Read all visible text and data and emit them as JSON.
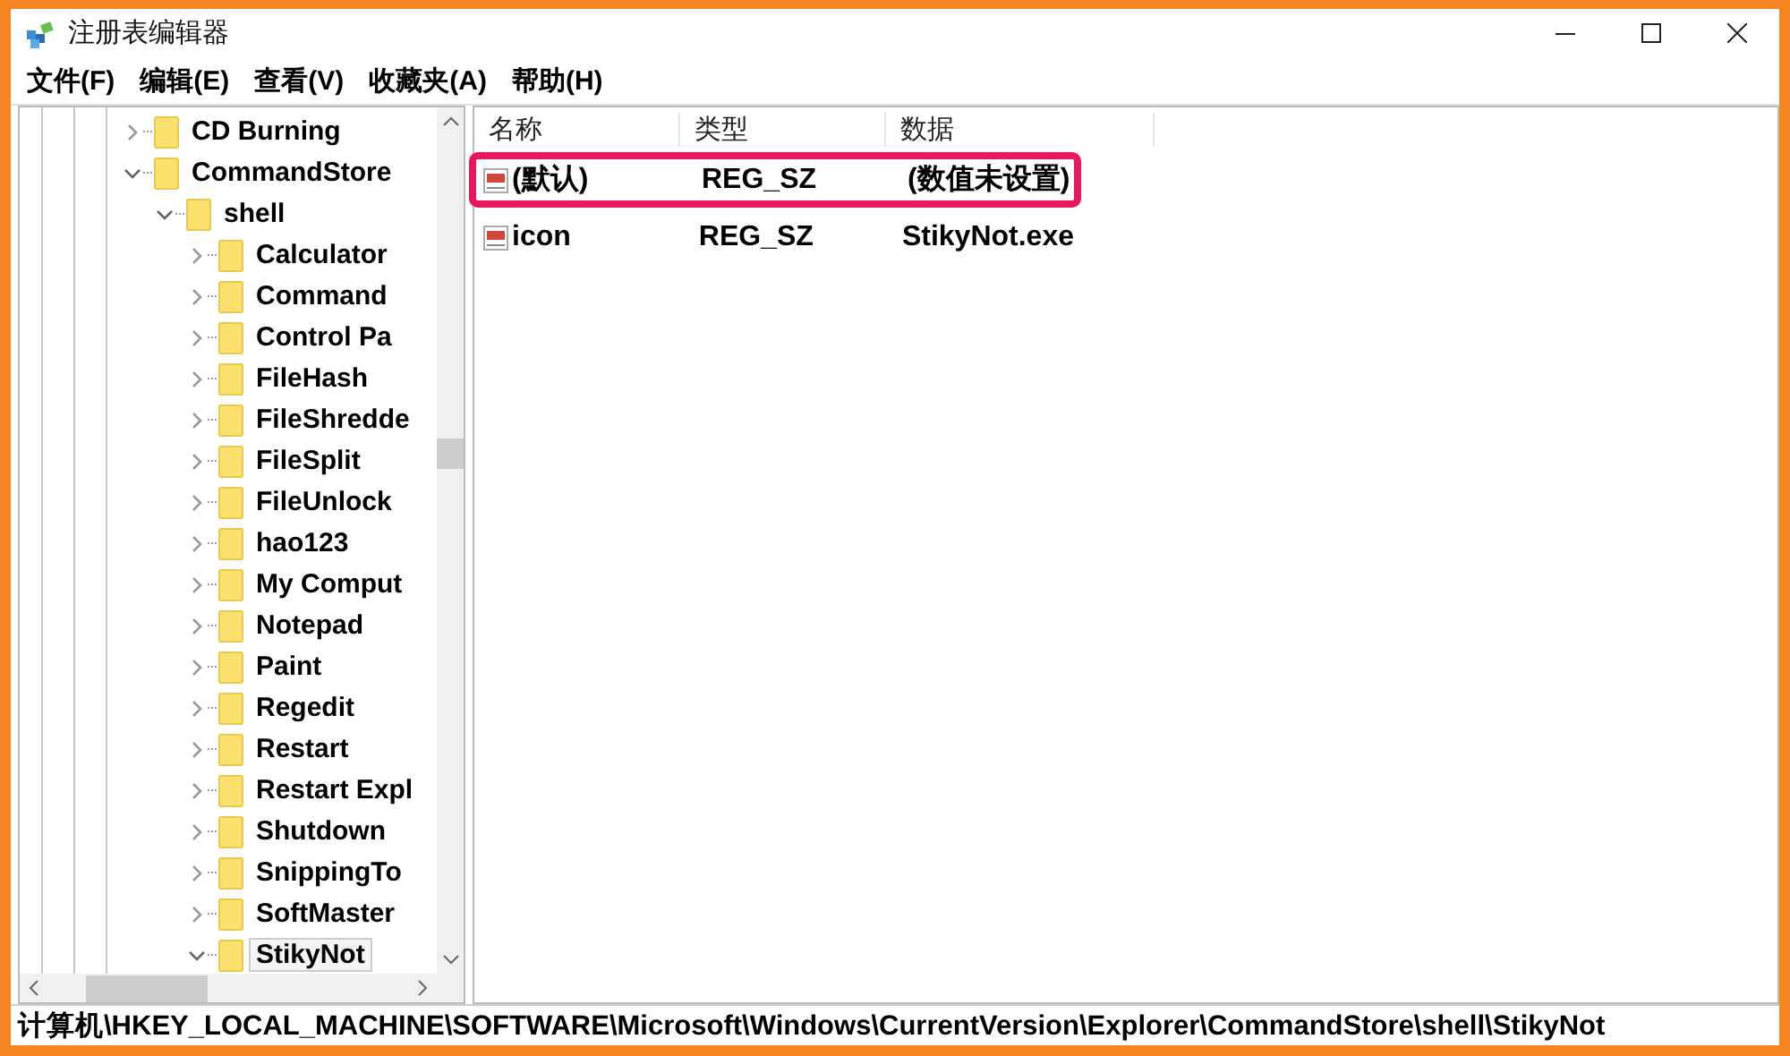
{
  "window": {
    "title": "注册表编辑器"
  },
  "menu": [
    "文件(F)",
    "编辑(E)",
    "查看(V)",
    "收藏夹(A)",
    "帮助(H)"
  ],
  "tree": [
    {
      "label": "CD Burning",
      "expanded": false,
      "selected": false
    },
    {
      "label": "CommandStore",
      "expanded": true,
      "selected": false,
      "children": [
        {
          "label": "shell",
          "expanded": true,
          "selected": false,
          "children": [
            {
              "label": "Calculator",
              "expanded": false,
              "selected": false
            },
            {
              "label": "Command",
              "expanded": false,
              "selected": false
            },
            {
              "label": "Control Pa",
              "expanded": false,
              "selected": false
            },
            {
              "label": "FileHash",
              "expanded": false,
              "selected": false
            },
            {
              "label": "FileShredde",
              "expanded": false,
              "selected": false
            },
            {
              "label": "FileSplit",
              "expanded": false,
              "selected": false
            },
            {
              "label": "FileUnlock",
              "expanded": false,
              "selected": false
            },
            {
              "label": "hao123",
              "expanded": false,
              "selected": false
            },
            {
              "label": "My Comput",
              "expanded": false,
              "selected": false
            },
            {
              "label": "Notepad",
              "expanded": false,
              "selected": false
            },
            {
              "label": "Paint",
              "expanded": false,
              "selected": false
            },
            {
              "label": "Regedit",
              "expanded": false,
              "selected": false
            },
            {
              "label": "Restart",
              "expanded": false,
              "selected": false
            },
            {
              "label": "Restart Expl",
              "expanded": false,
              "selected": false
            },
            {
              "label": "Shutdown",
              "expanded": false,
              "selected": false
            },
            {
              "label": "SnippingTo",
              "expanded": false,
              "selected": false
            },
            {
              "label": "SoftMaster",
              "expanded": false,
              "selected": false
            },
            {
              "label": "StikyNot",
              "expanded": true,
              "selected": true
            }
          ]
        }
      ]
    }
  ],
  "list": {
    "columns": [
      "名称",
      "类型",
      "数据"
    ],
    "rows": [
      {
        "name": "(默认)",
        "type": "REG_SZ",
        "data": "(数值未设置)",
        "highlighted": true
      },
      {
        "name": "icon",
        "type": "REG_SZ",
        "data": "StikyNot.exe",
        "highlighted": false
      }
    ]
  },
  "status_bar": "计算机\\HKEY_LOCAL_MACHINE\\SOFTWARE\\Microsoft\\Windows\\CurrentVersion\\Explorer\\CommandStore\\shell\\StikyNot"
}
